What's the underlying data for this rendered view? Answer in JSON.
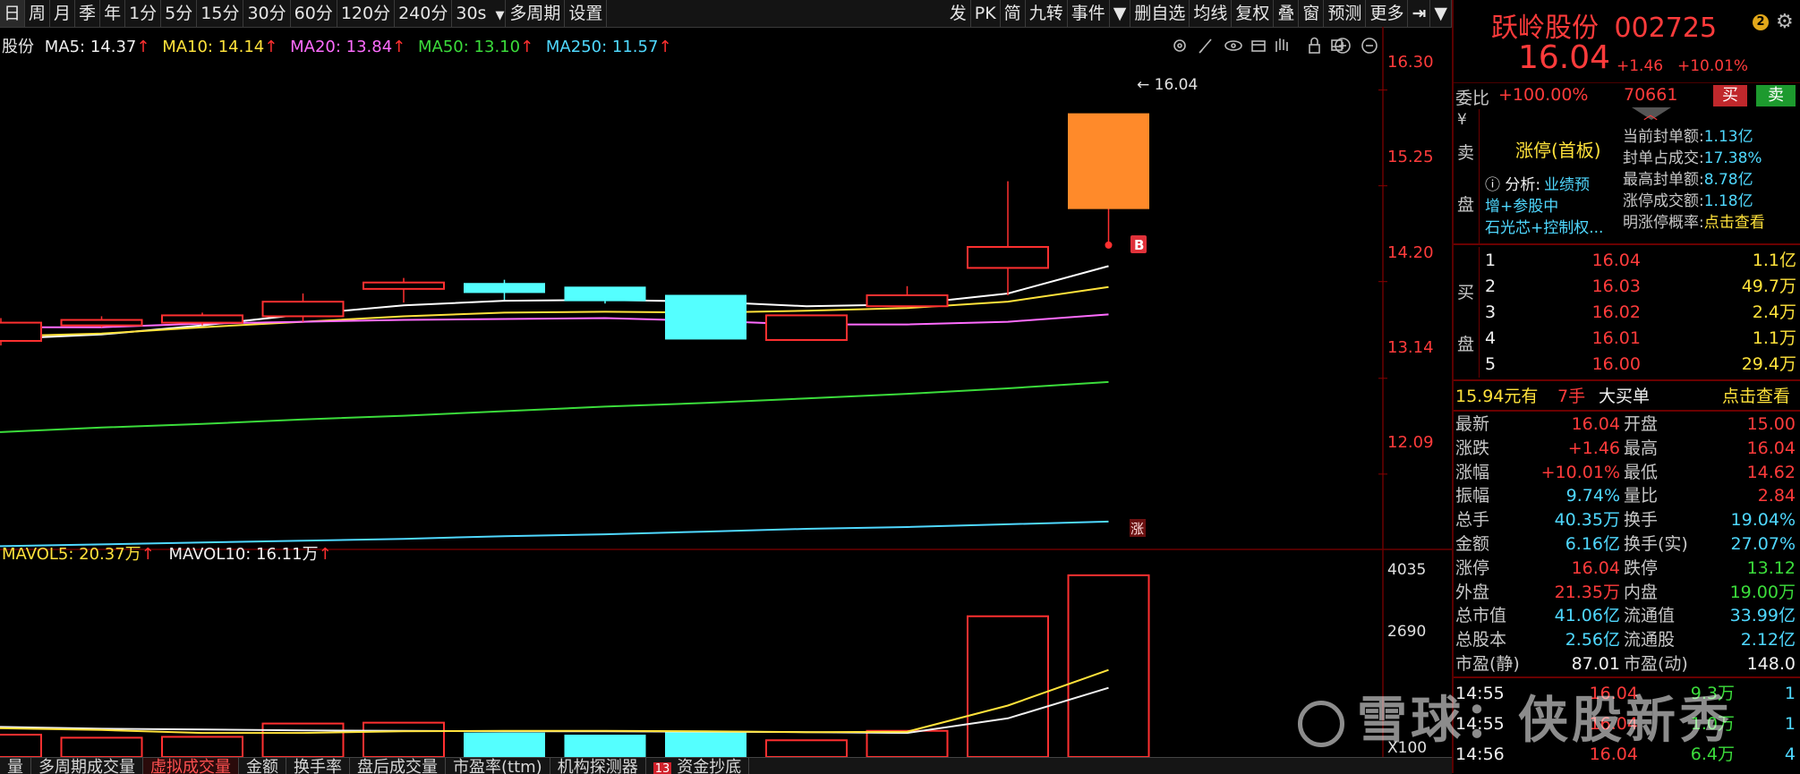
{
  "toolbar": {
    "periods": [
      "日",
      "周",
      "月",
      "季",
      "年",
      "1分",
      "5分",
      "15分",
      "30分",
      "60分",
      "120分",
      "240分",
      "30s",
      "多周期",
      "设置"
    ],
    "right_items": [
      "发",
      "PK",
      "简",
      "九转",
      "事件",
      "▼",
      "删自选",
      "均线",
      "复权",
      "叠",
      "窗",
      "预测",
      "更多"
    ]
  },
  "ma_legend": {
    "prefix": "股份",
    "ma5": "MA5: 14.37",
    "ma10": "MA10: 14.14",
    "ma20": "MA20: 13.84",
    "ma50": "MA50: 13.10",
    "ma250": "MA250: 11.57",
    "arrow": "↑"
  },
  "vol_legend": {
    "mavol5": "MAVOL5: 20.37万",
    "mavol10": "MAVOL10: 16.11万",
    "arrow": "↑"
  },
  "price_axis": [
    "16.30",
    "15.25",
    "14.20",
    "13.14",
    "12.09"
  ],
  "vol_axis": [
    "4035",
    "2690",
    "X100"
  ],
  "last_price_label": "← 16.04",
  "b_marker": "B",
  "zhang_marker": "涨",
  "chart_data": {
    "type": "candlestick",
    "ylim": [
      11.5,
      16.6
    ],
    "candles": [
      {
        "open": 13.75,
        "close": 13.55,
        "high": 13.8,
        "low": 13.5,
        "color": "up"
      },
      {
        "open": 13.72,
        "close": 13.78,
        "high": 13.82,
        "low": 13.7,
        "color": "up"
      },
      {
        "open": 13.75,
        "close": 13.83,
        "high": 13.86,
        "low": 13.72,
        "color": "up"
      },
      {
        "open": 13.82,
        "close": 13.98,
        "high": 14.07,
        "low": 13.76,
        "color": "up"
      },
      {
        "open": 14.12,
        "close": 14.19,
        "high": 14.24,
        "low": 13.97,
        "color": "up"
      },
      {
        "open": 14.18,
        "close": 14.08,
        "high": 14.22,
        "low": 14.0,
        "color": "down"
      },
      {
        "open": 14.14,
        "close": 13.99,
        "high": 14.14,
        "low": 13.96,
        "color": "down"
      },
      {
        "open": 14.05,
        "close": 13.57,
        "high": 14.05,
        "low": 13.57,
        "color": "down"
      },
      {
        "open": 13.56,
        "close": 13.83,
        "high": 13.83,
        "low": 13.56,
        "color": "up"
      },
      {
        "open": 13.93,
        "close": 14.05,
        "high": 14.15,
        "low": 13.93,
        "color": "up"
      },
      {
        "open": 14.35,
        "close": 14.58,
        "high": 15.3,
        "low": 14.05,
        "color": "up"
      },
      {
        "open": 15.0,
        "close": 16.04,
        "high": 16.04,
        "low": 14.62,
        "color": "up"
      }
    ],
    "ma_series": [
      {
        "name": "MA5",
        "color": "#ffffff",
        "values": [
          13.57,
          13.62,
          13.72,
          13.84,
          13.94,
          13.99,
          14.0,
          13.98,
          13.93,
          13.95,
          14.07,
          14.37
        ]
      },
      {
        "name": "MA10",
        "color": "#ffe23b",
        "values": [
          13.6,
          13.63,
          13.7,
          13.76,
          13.82,
          13.86,
          13.87,
          13.86,
          13.88,
          13.91,
          13.98,
          14.14
        ]
      },
      {
        "name": "MA20",
        "color": "#ff6cff",
        "values": [
          13.7,
          13.7,
          13.74,
          13.76,
          13.78,
          13.79,
          13.8,
          13.77,
          13.73,
          13.73,
          13.76,
          13.84
        ]
      },
      {
        "name": "MA50",
        "color": "#3bdc3b",
        "values": [
          12.55,
          12.6,
          12.64,
          12.69,
          12.73,
          12.78,
          12.83,
          12.87,
          12.92,
          12.97,
          13.03,
          13.1
        ]
      },
      {
        "name": "MA250",
        "color": "#4fd8ff",
        "values": [
          11.3,
          11.32,
          11.34,
          11.36,
          11.38,
          11.41,
          11.43,
          11.46,
          11.49,
          11.51,
          11.54,
          11.57
        ]
      }
    ],
    "volumes": [
      {
        "v": 520,
        "color": "up"
      },
      {
        "v": 450,
        "color": "up"
      },
      {
        "v": 470,
        "color": "up"
      },
      {
        "v": 780,
        "color": "up"
      },
      {
        "v": 800,
        "color": "up"
      },
      {
        "v": 560,
        "color": "down"
      },
      {
        "v": 510,
        "color": "down"
      },
      {
        "v": 590,
        "color": "down"
      },
      {
        "v": 390,
        "color": "up"
      },
      {
        "v": 610,
        "color": "up"
      },
      {
        "v": 3280,
        "color": "up"
      },
      {
        "v": 4235,
        "color": "up"
      }
    ],
    "vol_ylim": [
      0,
      4400
    ],
    "mavol5": [
      670,
      630,
      560,
      560,
      600,
      610,
      610,
      600,
      580,
      590,
      1200,
      2030
    ],
    "mavol10": [
      700,
      660,
      640,
      620,
      610,
      600,
      600,
      590,
      580,
      560,
      900,
      1611
    ]
  },
  "panel": {
    "name": "跃岭股份",
    "code": "002725",
    "badge": "2",
    "price": "16.04",
    "change": "+1.46",
    "change_pct": "+10.01%",
    "webi_label": "委比",
    "webi_value": "+100.00%",
    "webi_qty": "70661",
    "buy_btn": "买",
    "sell_btn": "卖",
    "yen": "¥",
    "sell_label": "卖",
    "pan_label": "盘",
    "limit_title": "涨停(首板)",
    "analysis_label": "ⓘ 分析:",
    "analysis_text1": "业绩预",
    "analysis_text2": "增+参股中",
    "analysis_text3": "石光芯+控制权...",
    "seal_rows": [
      {
        "label": "当前封单额:",
        "value": "1.13亿"
      },
      {
        "label": "封单占成交:",
        "value": "17.38%"
      },
      {
        "label": "最高封单额:",
        "value": "8.78亿"
      },
      {
        "label": "涨停成交额:",
        "value": "1.18亿"
      }
    ],
    "prob_label": "明涨停概率:",
    "prob_link": "点击查看",
    "buy_label": "买",
    "buy_rows": [
      {
        "idx": "1",
        "price": "16.04",
        "vol": "1.1亿"
      },
      {
        "idx": "2",
        "price": "16.03",
        "vol": "49.7万"
      },
      {
        "idx": "3",
        "price": "16.02",
        "vol": "2.4万"
      },
      {
        "idx": "4",
        "price": "16.01",
        "vol": "1.1万"
      },
      {
        "idx": "5",
        "price": "16.00",
        "vol": "29.4万"
      }
    ],
    "big_buy_price": "15.94元有",
    "big_buy_qty": "7手",
    "big_buy_label": "大买单",
    "big_buy_link": "点击查看",
    "stats": [
      {
        "l1": "最新",
        "v1": "16.04",
        "c1": "red",
        "l2": "开盘",
        "v2": "15.00",
        "c2": "red"
      },
      {
        "l1": "涨跌",
        "v1": "+1.46",
        "c1": "red",
        "l2": "最高",
        "v2": "16.04",
        "c2": "red"
      },
      {
        "l1": "涨幅",
        "v1": "+10.01%",
        "c1": "red",
        "l2": "最低",
        "v2": "14.62",
        "c2": "red"
      },
      {
        "l1": "振幅",
        "v1": "9.74%",
        "c1": "cyan",
        "l2": "量比",
        "v2": "2.84",
        "c2": "red"
      },
      {
        "l1": "总手",
        "v1": "40.35万",
        "c1": "cyan",
        "l2": "换手",
        "v2": "19.04%",
        "c2": "cyan"
      },
      {
        "l1": "金额",
        "v1": "6.16亿",
        "c1": "cyan",
        "l2": "换手(实)",
        "v2": "27.07%",
        "c2": "cyan"
      },
      {
        "l1": "涨停",
        "v1": "16.04",
        "c1": "red",
        "l2": "跌停",
        "v2": "13.12",
        "c2": "green"
      },
      {
        "l1": "外盘",
        "v1": "21.35万",
        "c1": "red",
        "l2": "内盘",
        "v2": "19.00万",
        "c2": "green"
      },
      {
        "l1": "总市值",
        "v1": "41.06亿",
        "c1": "cyan",
        "l2": "流通值",
        "v2": "33.99亿",
        "c2": "cyan"
      },
      {
        "l1": "总股本",
        "v1": "2.56亿",
        "c1": "cyan",
        "l2": "流通股",
        "v2": "2.12亿",
        "c2": "cyan"
      },
      {
        "l1": "市盈(静)",
        "v1": "87.01",
        "c1": "white",
        "l2": "市盈(动)",
        "v2": "148.0",
        "c2": "white"
      }
    ],
    "ticks": [
      {
        "time": "14:55",
        "price": "16.04",
        "vol": "9.3万",
        "n": "1"
      },
      {
        "time": "14:55",
        "price": "16.04",
        "vol": "1.0万",
        "n": "1"
      },
      {
        "time": "14:56",
        "price": "16.04",
        "vol": "6.4万",
        "n": "4"
      }
    ]
  },
  "bottom_tabs": [
    "量",
    "多周期成交量",
    "虚拟成交量",
    "金额",
    "换手率",
    "盘后成交量",
    "市盈率(ttm)",
    "机构探测器",
    "资金抄底"
  ],
  "bottom_badge": "13",
  "watermark": "雪球：侠股新秀",
  "colors": {
    "up": "#ff3030",
    "down": "#54ffff",
    "bg": "#000000"
  }
}
